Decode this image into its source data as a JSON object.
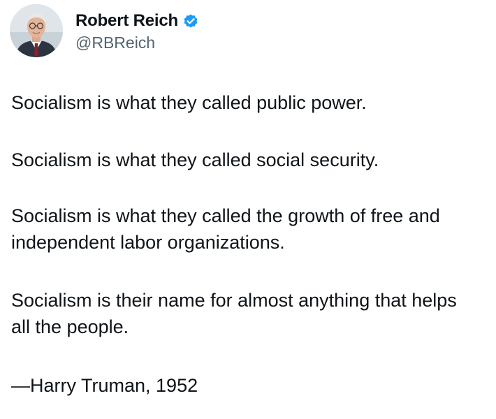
{
  "author": {
    "display_name": "Robert Reich",
    "handle": "@RBReich",
    "avatar_icon": "profile-photo",
    "verified_icon": "verified-badge-icon",
    "verified_color": "#1d9bf0"
  },
  "tweet": {
    "paragraphs": [
      "Socialism is what they called public power.",
      "Socialism is what they called social security.",
      "Socialism is what they called the growth of free and independent labor organizations.",
      "Socialism is their name for almost anything that helps all the people.",
      "—Harry Truman, 1952"
    ]
  }
}
